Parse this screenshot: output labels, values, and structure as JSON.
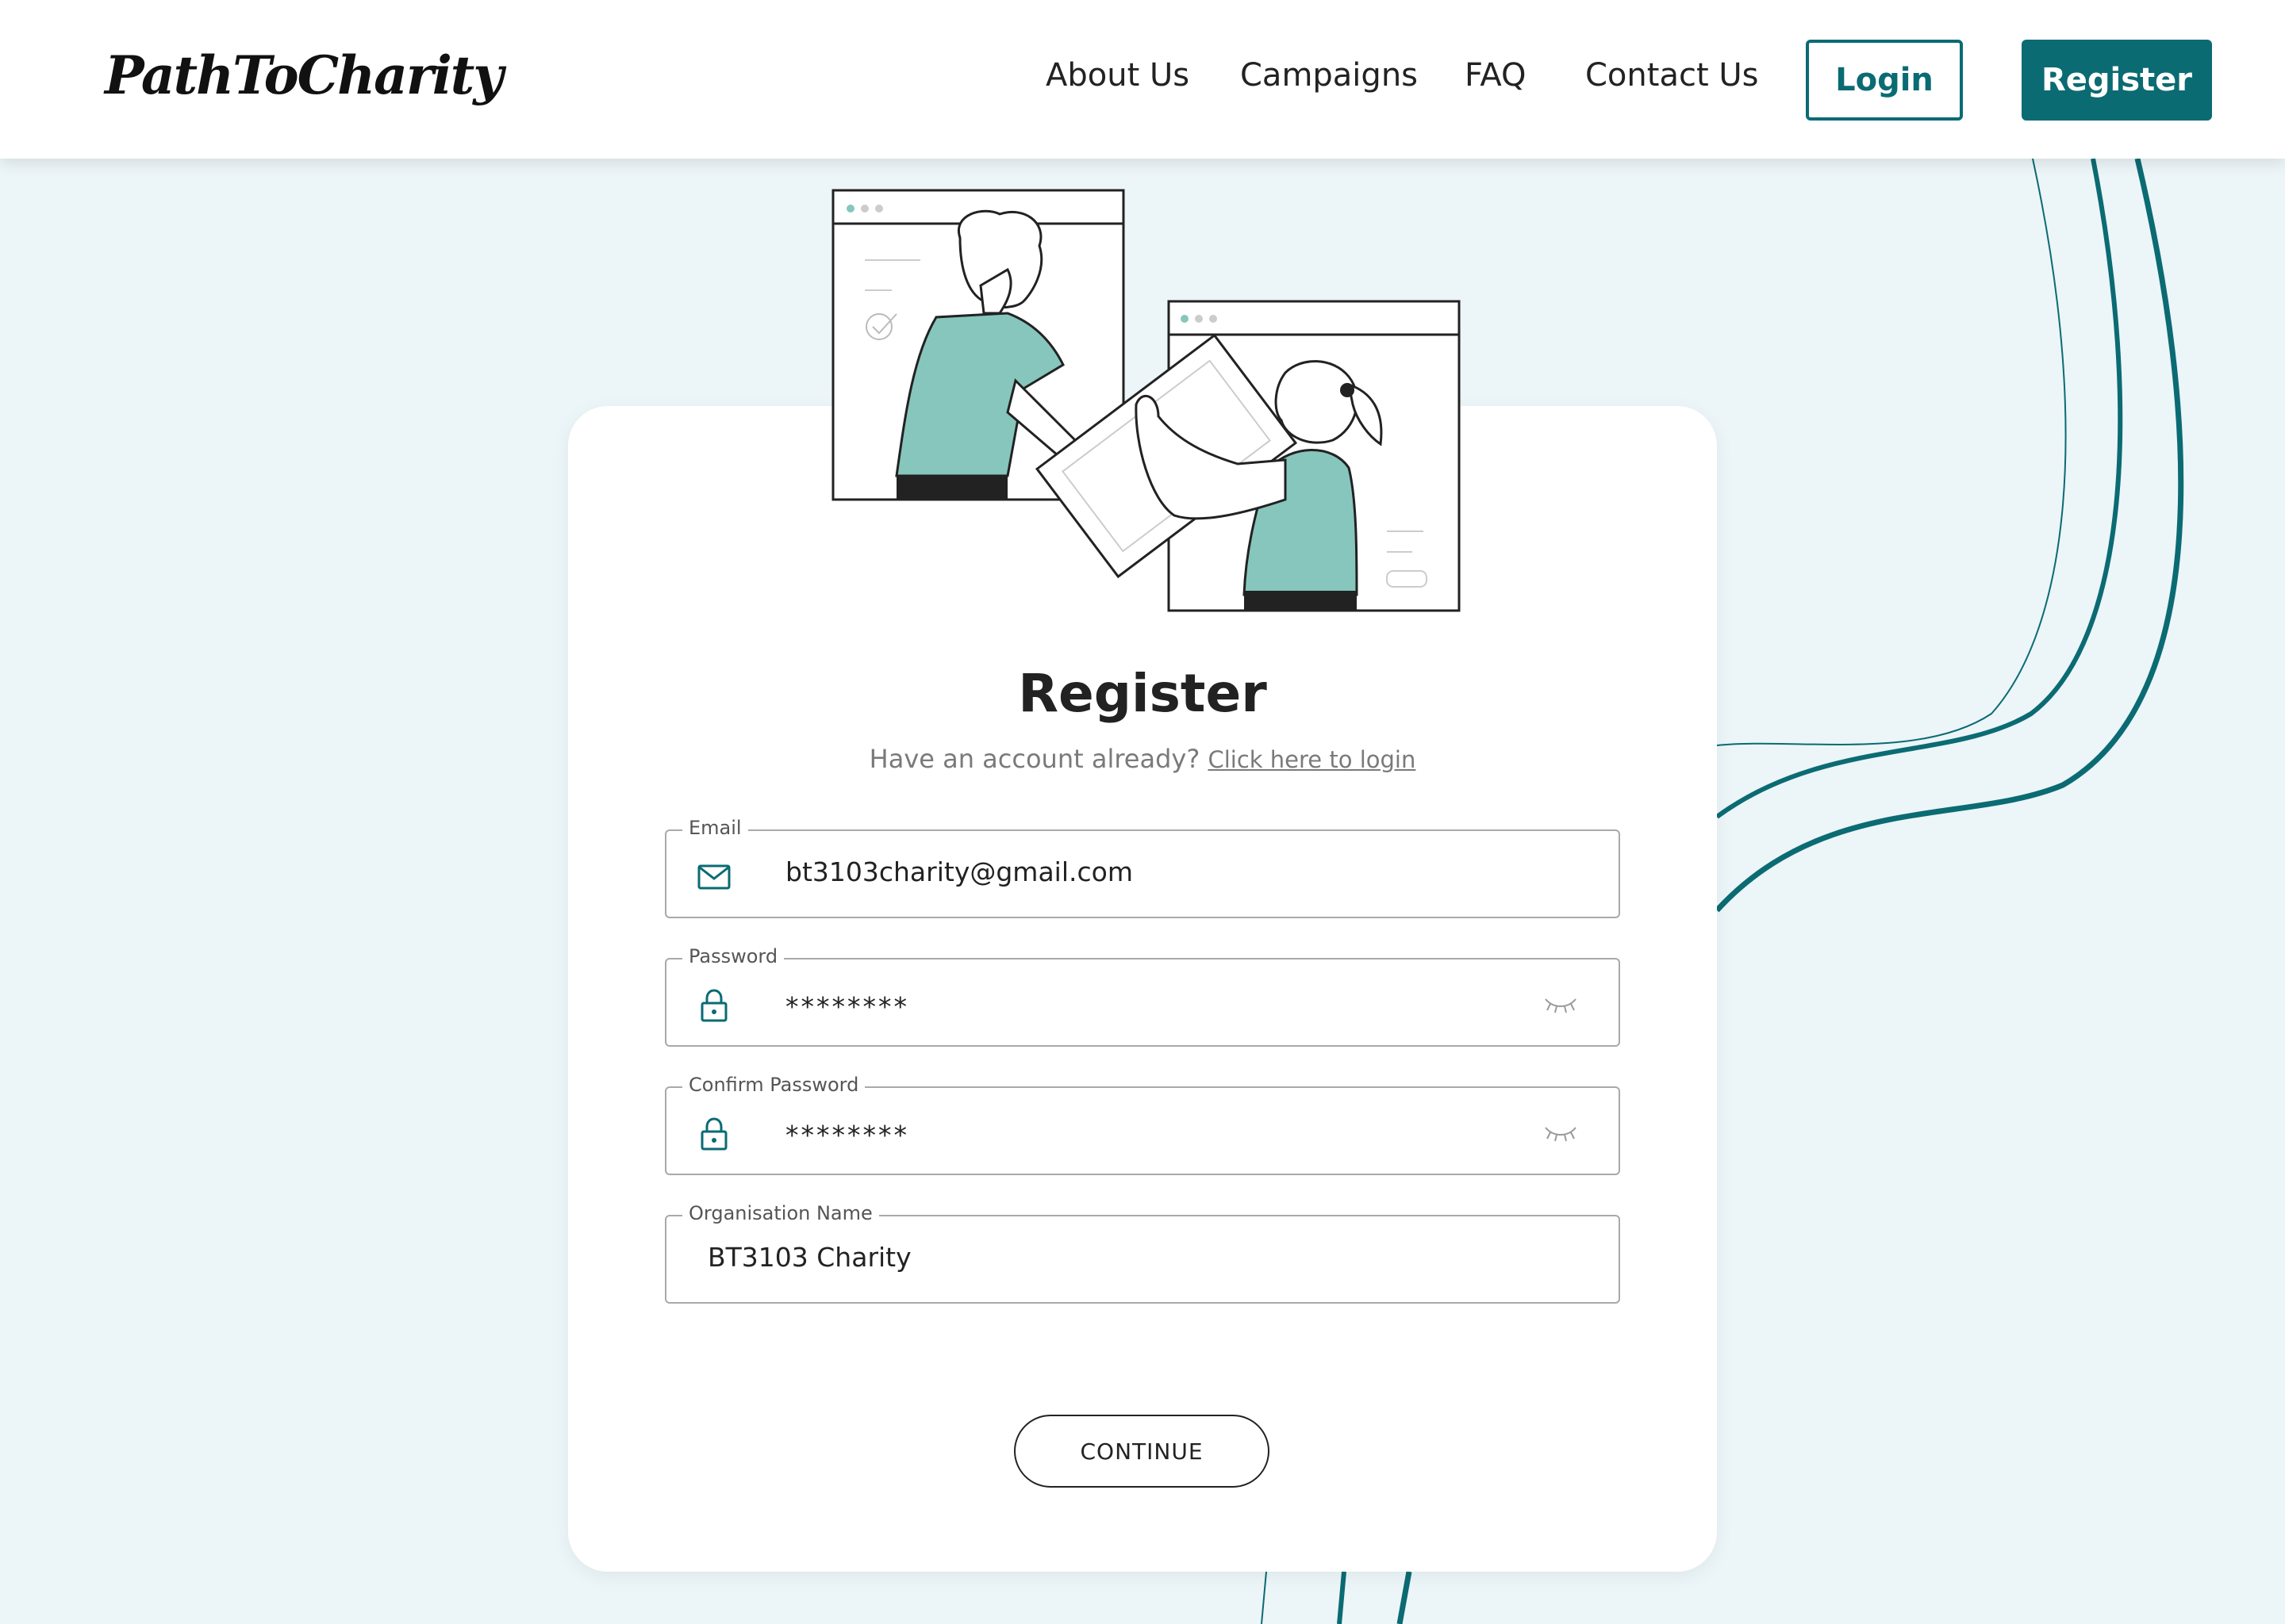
{
  "header": {
    "logo": "PathToCharity",
    "nav": {
      "about": "About Us",
      "campaigns": "Campaigns",
      "faq": "FAQ",
      "contact": "Contact Us"
    },
    "login_label": "Login",
    "register_label": "Register"
  },
  "form": {
    "title": "Register",
    "subtitle_text": "Have an account already?",
    "subtitle_link": "Click here to login",
    "email": {
      "label": "Email",
      "value": "bt3103charity@gmail.com",
      "icon": "mail-icon"
    },
    "password": {
      "label": "Password",
      "value": "********",
      "icon": "lock-icon",
      "toggle_icon": "eye-closed-icon"
    },
    "confirm_password": {
      "label": "Confirm Password",
      "value": "********",
      "icon": "lock-icon",
      "toggle_icon": "eye-closed-icon"
    },
    "organisation": {
      "label": "Organisation Name",
      "value": "BT3103 Charity"
    },
    "continue_label": "CONTINUE"
  },
  "colors": {
    "brand": "#0b6b73",
    "background": "#ecf5f8",
    "accent": "#86c6bd",
    "card": "#ffffff"
  }
}
